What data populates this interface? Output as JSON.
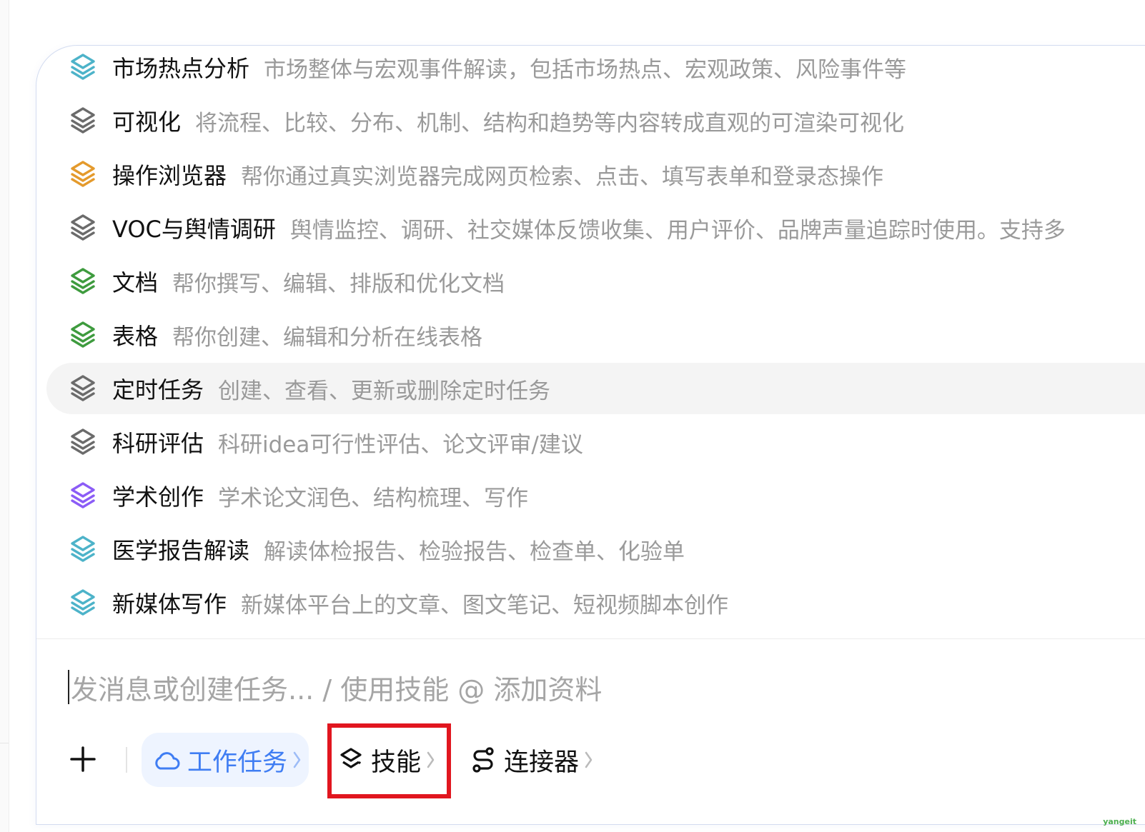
{
  "skills": [
    {
      "name": "市场热点分析",
      "desc": "市场整体与宏观事件解读，包括市场热点、宏观政策、风险事件等",
      "icon": "layers-icon",
      "color": "#4db3c9"
    },
    {
      "name": "可视化",
      "desc": "将流程、比较、分布、机制、结构和趋势等内容转成直观的可渲染可视化",
      "icon": "layers-icon",
      "color": "#6b6b6b"
    },
    {
      "name": "操作浏览器",
      "desc": "帮你通过真实浏览器完成网页检索、点击、填写表单和登录态操作",
      "icon": "layers-icon",
      "color": "#e49a2c"
    },
    {
      "name": "VOC与舆情调研",
      "desc": "舆情监控、调研、社交媒体反馈收集、用户评价、品牌声量追踪时使用。支持多",
      "icon": "layers-icon",
      "color": "#6b6b6b"
    },
    {
      "name": "文档",
      "desc": "帮你撰写、编辑、排版和优化文档",
      "icon": "layers-icon",
      "color": "#3e9b3e"
    },
    {
      "name": "表格",
      "desc": "帮你创建、编辑和分析在线表格",
      "icon": "layers-icon",
      "color": "#3e9b3e"
    },
    {
      "name": "定时任务",
      "desc": "创建、查看、更新或删除定时任务",
      "icon": "layers-icon",
      "color": "#6b6b6b"
    },
    {
      "name": "科研评估",
      "desc": "科研idea可行性评估、论文评审/建议",
      "icon": "layers-icon",
      "color": "#6b6b6b"
    },
    {
      "name": "学术创作",
      "desc": "学术论文润色、结构梳理、写作",
      "icon": "layers-icon",
      "color": "#8b5cf6"
    },
    {
      "name": "医学报告解读",
      "desc": "解读体检报告、检验报告、检查单、化验单",
      "icon": "layers-icon",
      "color": "#4db3c9"
    },
    {
      "name": "新媒体写作",
      "desc": "新媒体平台上的文章、图文笔记、短视频脚本创作",
      "icon": "layers-icon",
      "color": "#4db3c9"
    }
  ],
  "hovered_skill": "定时任务",
  "input": {
    "placeholder": "发消息或创建任务... / 使用技能 @ 添加资料",
    "value": ""
  },
  "toolbar": {
    "add_icon": "plus-icon",
    "work_task_label": "工作任务",
    "work_task_icon": "cloud-icon",
    "skills_label": "技能",
    "skills_icon": "layers-icon",
    "connector_label": "连接器",
    "connector_icon": "connector-icon",
    "chevron_icon": "chevron-right-icon"
  },
  "colors": {
    "accent": "#3f7df3",
    "highlight": "#e1161f",
    "muted_text": "#9a9a9a"
  },
  "watermark": "yangeit"
}
